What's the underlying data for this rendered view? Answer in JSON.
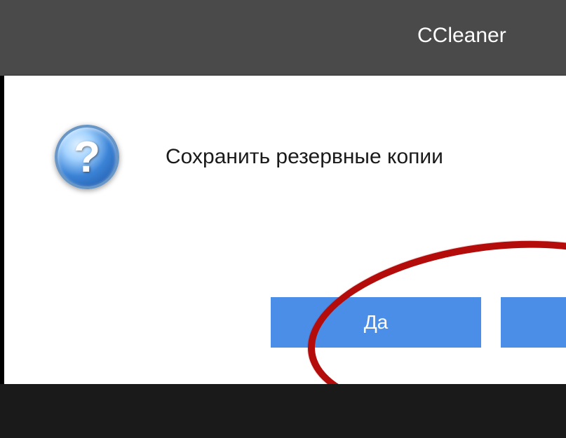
{
  "titlebar": {
    "app_name": "CCleaner"
  },
  "dialog": {
    "message": "Сохранить резервные копии",
    "icon": "question-icon",
    "buttons": {
      "yes": "Да",
      "no": ""
    }
  }
}
